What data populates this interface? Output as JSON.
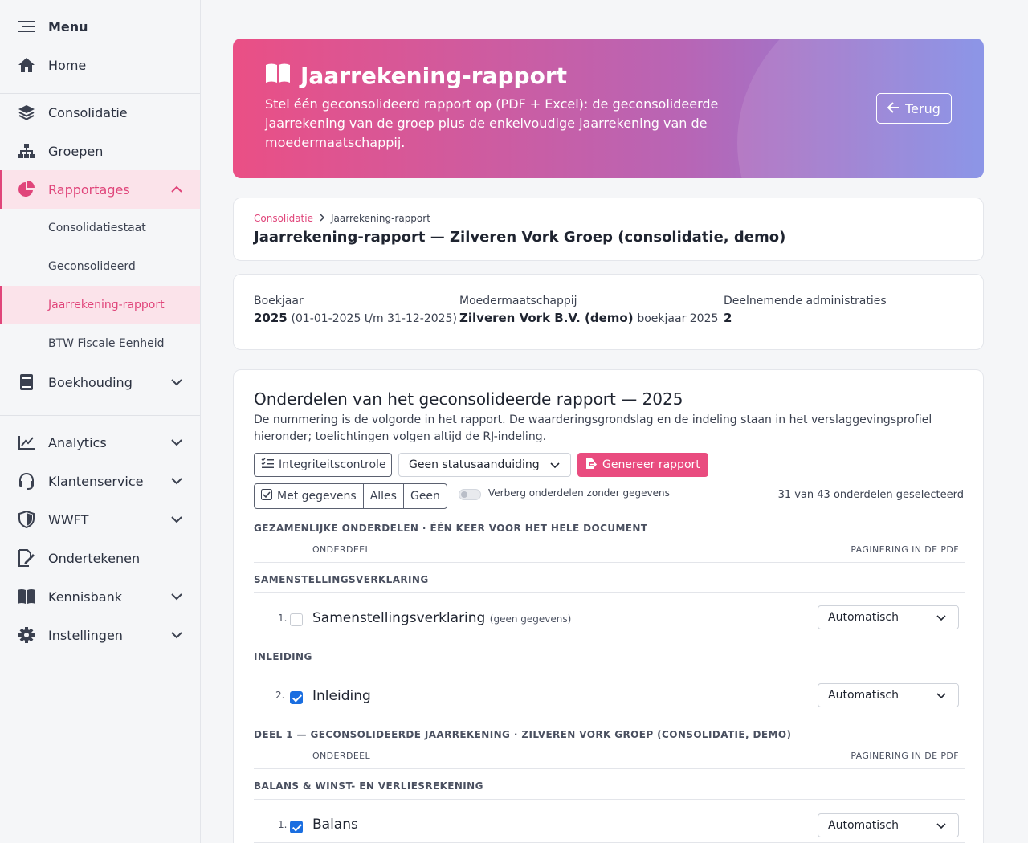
{
  "sidebar": {
    "menu": "Menu",
    "home": "Home",
    "consolidatie": "Consolidatie",
    "groepen": "Groepen",
    "rapportages": "Rapportages",
    "sub": [
      "Consolidatiestaat",
      "Geconsolideerd",
      "Jaarrekening-rapport",
      "BTW Fiscale Eenheid"
    ],
    "boekhouding": "Boekhouding",
    "analytics": "Analytics",
    "klantenservice": "Klantenservice",
    "wwft": "WWFT",
    "ondertekenen": "Ondertekenen",
    "kennisbank": "Kennisbank",
    "instellingen": "Instellingen"
  },
  "banner": {
    "title": "Jaarrekening-rapport",
    "description": "Stel één geconsolideerd rapport op (PDF + Excel): de geconsolideerde jaarrekening van de groep plus de enkelvoudige jaarrekening van de moedermaatschappij.",
    "back": "Terug"
  },
  "breadcrumb": {
    "parent": "Consolidatie",
    "current": "Jaarrekening-rapport"
  },
  "page_title": "Jaarrekening-rapport — Zilveren Vork Groep (consolidatie, demo)",
  "info": {
    "boekjaar_label": "Boekjaar",
    "boekjaar_value": "2025",
    "boekjaar_range": "(01-01-2025 t/m 31-12-2025)",
    "moeder_label": "Moedermaatschappij",
    "moeder_value": "Zilveren Vork B.V. (demo)",
    "moeder_extra": "boekjaar 2025",
    "deeln_label": "Deelnemende administraties",
    "deeln_value": "2"
  },
  "section": {
    "title": "Onderdelen van het geconsolideerde rapport — 2025",
    "desc": "De nummering is de volgorde in het rapport. De waarderingsgrondslag en de indeling staan in het verslaggevingsprofiel hieronder; toelichtingen volgen altijd de RJ-indeling.",
    "integrity": "Integriteitscontrole",
    "status_select": "Geen statusaanduiding",
    "generate": "Genereer rapport",
    "filter_with": "Met gegevens",
    "filter_all": "Alles",
    "filter_none": "Geen",
    "hide_toggle": "Verberg onderdelen zonder gegevens",
    "counter": "31 van 43 onderdelen geselecteerd"
  },
  "table": {
    "col_onderdeel": "Onderdeel",
    "col_paginering": "Paginering in de PDF",
    "group1": "Gezamenlijke onderdelen · één keer voor het hele document",
    "sub_samenstel": "Samenstellingsverklaring",
    "row1_num": "1.",
    "row1_label": "Samenstellingsverklaring",
    "row1_note": "(geen gegevens)",
    "row1_select": "Automatisch",
    "sub_inleiding": "Inleiding",
    "row2_num": "2.",
    "row2_label": "Inleiding",
    "row2_select": "Automatisch",
    "group2": "Deel 1 — Geconsolideerde jaarrekening · Zilveren Vork Groep (consolidatie, demo)",
    "sub_balans": "Balans & winst- en verliesrekening",
    "row3_num": "1.",
    "row3_label": "Balans",
    "row3_select": "Automatisch"
  }
}
